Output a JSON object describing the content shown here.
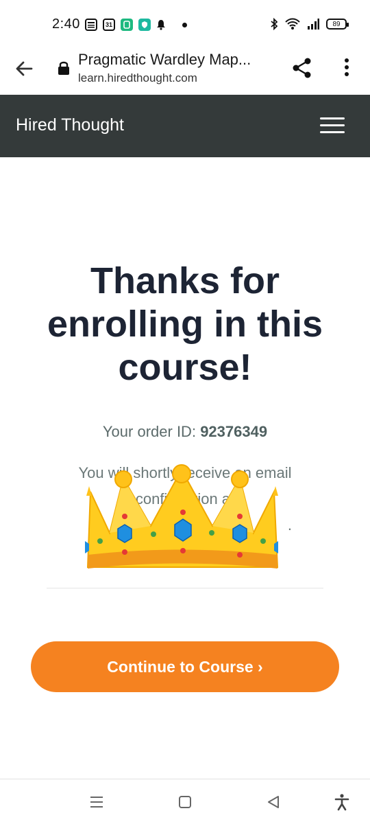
{
  "status_bar": {
    "time": "2:40",
    "calendar_day": "31",
    "battery": "89",
    "icons": [
      "news-icon",
      "calendar-icon",
      "green-app-icon",
      "shield-app-icon",
      "bell-icon",
      "dot-icon",
      "bluetooth-icon",
      "wifi-icon",
      "signal-icon",
      "battery-icon"
    ]
  },
  "browser": {
    "page_title": "Pragmatic Wardley Map...",
    "host": "learn.hiredthought.com"
  },
  "site": {
    "brand": "Hired Thought"
  },
  "main": {
    "headline": "Thanks for enrolling in this course!",
    "order_label": "Your order ID:",
    "order_id": "92376349",
    "email_line1": "You will shortly receive an email",
    "email_line2": "confirmation at",
    "email_line3": ".",
    "continue_label": "Continue to Course ›"
  },
  "colors": {
    "header_bg": "#343a3a",
    "accent": "#f58220",
    "headline": "#1d2434"
  }
}
